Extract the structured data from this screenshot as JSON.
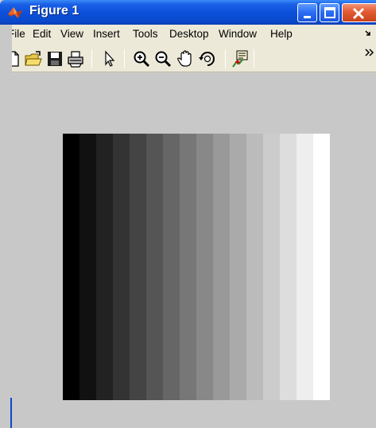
{
  "window": {
    "title": "Figure 1",
    "controls": [
      "minimize",
      "maximize",
      "close"
    ]
  },
  "menubar": {
    "items": [
      "File",
      "Edit",
      "View",
      "Insert",
      "Tools",
      "Desktop",
      "Window",
      "Help"
    ]
  },
  "toolbar": {
    "tools": [
      {
        "name": "new-figure",
        "icon": "new-document-icon"
      },
      {
        "name": "open-file",
        "icon": "open-folder-icon"
      },
      {
        "name": "save-figure",
        "icon": "save-disk-icon"
      },
      {
        "name": "print-figure",
        "icon": "printer-icon"
      },
      {
        "name": "edit-plot",
        "icon": "arrow-pointer-icon"
      },
      {
        "name": "zoom-in",
        "icon": "zoom-in-icon"
      },
      {
        "name": "zoom-out",
        "icon": "zoom-out-icon"
      },
      {
        "name": "pan",
        "icon": "hand-icon"
      },
      {
        "name": "rotate-3d",
        "icon": "rotate-icon"
      },
      {
        "name": "data-cursor",
        "icon": "data-cursor-icon"
      }
    ]
  },
  "figure": {
    "image": "grayscale-gradient",
    "bands": 16,
    "colors": {
      "accent_title": "#0a49cc",
      "background": "#c8c8c8"
    }
  }
}
